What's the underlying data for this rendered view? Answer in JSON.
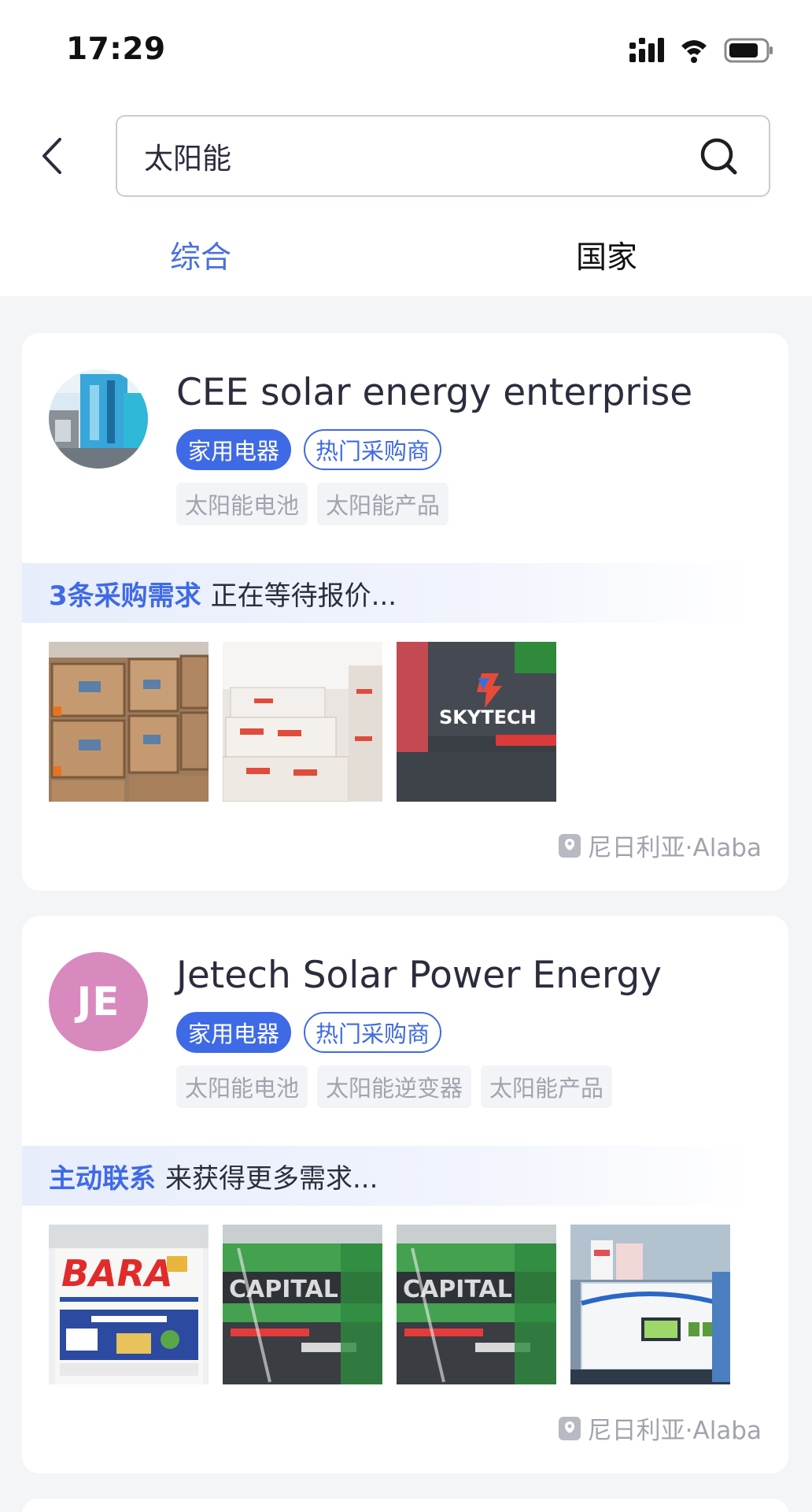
{
  "status_bar": {
    "time": "17:29"
  },
  "search": {
    "query": "太阳能"
  },
  "tabs": [
    {
      "label": "综合"
    },
    {
      "label": "国家"
    }
  ],
  "results": [
    {
      "avatar_text": "",
      "name": "CEE solar energy enterprise",
      "badges": [
        "家用电器",
        "热门采购商"
      ],
      "tags": [
        "太阳能电池",
        "太阳能产品"
      ],
      "demand_highlight": "3条采购需求",
      "demand_text": "正在等待报价...",
      "location": "尼日利亚·Alaba"
    },
    {
      "avatar_text": "JE",
      "name": "Jetech Solar Power Energy",
      "badges": [
        "家用电器",
        "热门采购商"
      ],
      "tags": [
        "太阳能电池",
        "太阳能逆变器",
        "太阳能产品"
      ],
      "demand_highlight": "主动联系",
      "demand_text": "来获得更多需求...",
      "location": "尼日利亚·Alaba"
    }
  ],
  "photo_text": {
    "skytech": "SKYTECH",
    "bara": "BARA",
    "capital": "CAPITAL"
  }
}
